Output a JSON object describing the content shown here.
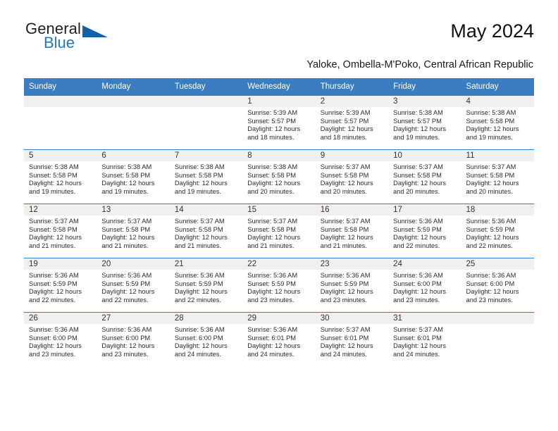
{
  "brand": {
    "name_primary": "General",
    "name_secondary": "Blue",
    "triangle_color": "#1362a8",
    "accent_color": "#1c7ac0"
  },
  "header": {
    "title": "May 2024",
    "location": "Yaloke, Ombella-M'Poko, Central African Republic"
  },
  "calendar": {
    "header_bg": "#3a7dc0",
    "daynum_bg": "#f0f0f0",
    "weekdays": [
      "Sunday",
      "Monday",
      "Tuesday",
      "Wednesday",
      "Thursday",
      "Friday",
      "Saturday"
    ],
    "weeks": [
      [
        {
          "day": ""
        },
        {
          "day": ""
        },
        {
          "day": ""
        },
        {
          "day": "1",
          "sunrise": "Sunrise: 5:39 AM",
          "sunset": "Sunset: 5:57 PM",
          "daylight1": "Daylight: 12 hours",
          "daylight2": "and 18 minutes."
        },
        {
          "day": "2",
          "sunrise": "Sunrise: 5:39 AM",
          "sunset": "Sunset: 5:57 PM",
          "daylight1": "Daylight: 12 hours",
          "daylight2": "and 18 minutes."
        },
        {
          "day": "3",
          "sunrise": "Sunrise: 5:38 AM",
          "sunset": "Sunset: 5:57 PM",
          "daylight1": "Daylight: 12 hours",
          "daylight2": "and 19 minutes."
        },
        {
          "day": "4",
          "sunrise": "Sunrise: 5:38 AM",
          "sunset": "Sunset: 5:58 PM",
          "daylight1": "Daylight: 12 hours",
          "daylight2": "and 19 minutes."
        }
      ],
      [
        {
          "day": "5",
          "sunrise": "Sunrise: 5:38 AM",
          "sunset": "Sunset: 5:58 PM",
          "daylight1": "Daylight: 12 hours",
          "daylight2": "and 19 minutes."
        },
        {
          "day": "6",
          "sunrise": "Sunrise: 5:38 AM",
          "sunset": "Sunset: 5:58 PM",
          "daylight1": "Daylight: 12 hours",
          "daylight2": "and 19 minutes."
        },
        {
          "day": "7",
          "sunrise": "Sunrise: 5:38 AM",
          "sunset": "Sunset: 5:58 PM",
          "daylight1": "Daylight: 12 hours",
          "daylight2": "and 19 minutes."
        },
        {
          "day": "8",
          "sunrise": "Sunrise: 5:38 AM",
          "sunset": "Sunset: 5:58 PM",
          "daylight1": "Daylight: 12 hours",
          "daylight2": "and 20 minutes."
        },
        {
          "day": "9",
          "sunrise": "Sunrise: 5:37 AM",
          "sunset": "Sunset: 5:58 PM",
          "daylight1": "Daylight: 12 hours",
          "daylight2": "and 20 minutes."
        },
        {
          "day": "10",
          "sunrise": "Sunrise: 5:37 AM",
          "sunset": "Sunset: 5:58 PM",
          "daylight1": "Daylight: 12 hours",
          "daylight2": "and 20 minutes."
        },
        {
          "day": "11",
          "sunrise": "Sunrise: 5:37 AM",
          "sunset": "Sunset: 5:58 PM",
          "daylight1": "Daylight: 12 hours",
          "daylight2": "and 20 minutes."
        }
      ],
      [
        {
          "day": "12",
          "sunrise": "Sunrise: 5:37 AM",
          "sunset": "Sunset: 5:58 PM",
          "daylight1": "Daylight: 12 hours",
          "daylight2": "and 21 minutes."
        },
        {
          "day": "13",
          "sunrise": "Sunrise: 5:37 AM",
          "sunset": "Sunset: 5:58 PM",
          "daylight1": "Daylight: 12 hours",
          "daylight2": "and 21 minutes."
        },
        {
          "day": "14",
          "sunrise": "Sunrise: 5:37 AM",
          "sunset": "Sunset: 5:58 PM",
          "daylight1": "Daylight: 12 hours",
          "daylight2": "and 21 minutes."
        },
        {
          "day": "15",
          "sunrise": "Sunrise: 5:37 AM",
          "sunset": "Sunset: 5:58 PM",
          "daylight1": "Daylight: 12 hours",
          "daylight2": "and 21 minutes."
        },
        {
          "day": "16",
          "sunrise": "Sunrise: 5:37 AM",
          "sunset": "Sunset: 5:58 PM",
          "daylight1": "Daylight: 12 hours",
          "daylight2": "and 21 minutes."
        },
        {
          "day": "17",
          "sunrise": "Sunrise: 5:36 AM",
          "sunset": "Sunset: 5:59 PM",
          "daylight1": "Daylight: 12 hours",
          "daylight2": "and 22 minutes."
        },
        {
          "day": "18",
          "sunrise": "Sunrise: 5:36 AM",
          "sunset": "Sunset: 5:59 PM",
          "daylight1": "Daylight: 12 hours",
          "daylight2": "and 22 minutes."
        }
      ],
      [
        {
          "day": "19",
          "sunrise": "Sunrise: 5:36 AM",
          "sunset": "Sunset: 5:59 PM",
          "daylight1": "Daylight: 12 hours",
          "daylight2": "and 22 minutes."
        },
        {
          "day": "20",
          "sunrise": "Sunrise: 5:36 AM",
          "sunset": "Sunset: 5:59 PM",
          "daylight1": "Daylight: 12 hours",
          "daylight2": "and 22 minutes."
        },
        {
          "day": "21",
          "sunrise": "Sunrise: 5:36 AM",
          "sunset": "Sunset: 5:59 PM",
          "daylight1": "Daylight: 12 hours",
          "daylight2": "and 22 minutes."
        },
        {
          "day": "22",
          "sunrise": "Sunrise: 5:36 AM",
          "sunset": "Sunset: 5:59 PM",
          "daylight1": "Daylight: 12 hours",
          "daylight2": "and 23 minutes."
        },
        {
          "day": "23",
          "sunrise": "Sunrise: 5:36 AM",
          "sunset": "Sunset: 5:59 PM",
          "daylight1": "Daylight: 12 hours",
          "daylight2": "and 23 minutes."
        },
        {
          "day": "24",
          "sunrise": "Sunrise: 5:36 AM",
          "sunset": "Sunset: 6:00 PM",
          "daylight1": "Daylight: 12 hours",
          "daylight2": "and 23 minutes."
        },
        {
          "day": "25",
          "sunrise": "Sunrise: 5:36 AM",
          "sunset": "Sunset: 6:00 PM",
          "daylight1": "Daylight: 12 hours",
          "daylight2": "and 23 minutes."
        }
      ],
      [
        {
          "day": "26",
          "sunrise": "Sunrise: 5:36 AM",
          "sunset": "Sunset: 6:00 PM",
          "daylight1": "Daylight: 12 hours",
          "daylight2": "and 23 minutes."
        },
        {
          "day": "27",
          "sunrise": "Sunrise: 5:36 AM",
          "sunset": "Sunset: 6:00 PM",
          "daylight1": "Daylight: 12 hours",
          "daylight2": "and 23 minutes."
        },
        {
          "day": "28",
          "sunrise": "Sunrise: 5:36 AM",
          "sunset": "Sunset: 6:00 PM",
          "daylight1": "Daylight: 12 hours",
          "daylight2": "and 24 minutes."
        },
        {
          "day": "29",
          "sunrise": "Sunrise: 5:36 AM",
          "sunset": "Sunset: 6:01 PM",
          "daylight1": "Daylight: 12 hours",
          "daylight2": "and 24 minutes."
        },
        {
          "day": "30",
          "sunrise": "Sunrise: 5:37 AM",
          "sunset": "Sunset: 6:01 PM",
          "daylight1": "Daylight: 12 hours",
          "daylight2": "and 24 minutes."
        },
        {
          "day": "31",
          "sunrise": "Sunrise: 5:37 AM",
          "sunset": "Sunset: 6:01 PM",
          "daylight1": "Daylight: 12 hours",
          "daylight2": "and 24 minutes."
        },
        {
          "day": ""
        }
      ]
    ]
  }
}
